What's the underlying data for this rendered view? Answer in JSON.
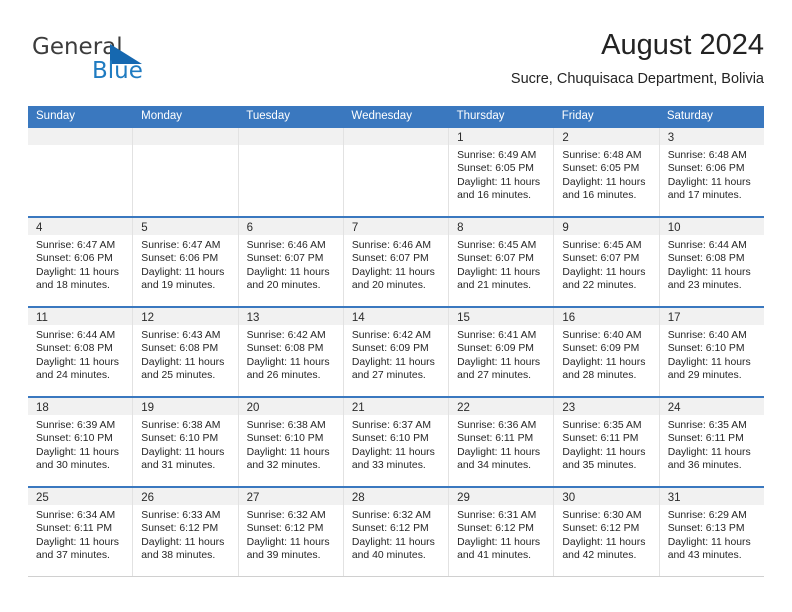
{
  "brand": {
    "name_top": "General",
    "name_bottom": "Blue",
    "color_dark": "#3c3c3c",
    "color_blue": "#1f7bc1",
    "triangle_color": "#1668b0"
  },
  "header": {
    "title": "August 2024",
    "subtitle": "Sucre, Chuquisaca Department, Bolivia"
  },
  "theme": {
    "header_row_bg": "#3a78bf",
    "header_row_text": "#ffffff",
    "week_divider": "#3a78bf",
    "day_band_bg": "#f1f1f1",
    "cell_border": "#e2e2e2"
  },
  "weekdays": [
    "Sunday",
    "Monday",
    "Tuesday",
    "Wednesday",
    "Thursday",
    "Friday",
    "Saturday"
  ],
  "labels": {
    "sunrise_prefix": "Sunrise:",
    "sunset_prefix": "Sunset:",
    "daylight_prefix": "Daylight:"
  },
  "weeks": [
    [
      {
        "day": "",
        "empty": true
      },
      {
        "day": "",
        "empty": true
      },
      {
        "day": "",
        "empty": true
      },
      {
        "day": "",
        "empty": true
      },
      {
        "day": "1",
        "sunrise": "Sunrise: 6:49 AM",
        "sunset": "Sunset: 6:05 PM",
        "daylight_1": "Daylight: 11 hours",
        "daylight_2": "and 16 minutes."
      },
      {
        "day": "2",
        "sunrise": "Sunrise: 6:48 AM",
        "sunset": "Sunset: 6:05 PM",
        "daylight_1": "Daylight: 11 hours",
        "daylight_2": "and 16 minutes."
      },
      {
        "day": "3",
        "sunrise": "Sunrise: 6:48 AM",
        "sunset": "Sunset: 6:06 PM",
        "daylight_1": "Daylight: 11 hours",
        "daylight_2": "and 17 minutes."
      }
    ],
    [
      {
        "day": "4",
        "sunrise": "Sunrise: 6:47 AM",
        "sunset": "Sunset: 6:06 PM",
        "daylight_1": "Daylight: 11 hours",
        "daylight_2": "and 18 minutes."
      },
      {
        "day": "5",
        "sunrise": "Sunrise: 6:47 AM",
        "sunset": "Sunset: 6:06 PM",
        "daylight_1": "Daylight: 11 hours",
        "daylight_2": "and 19 minutes."
      },
      {
        "day": "6",
        "sunrise": "Sunrise: 6:46 AM",
        "sunset": "Sunset: 6:07 PM",
        "daylight_1": "Daylight: 11 hours",
        "daylight_2": "and 20 minutes."
      },
      {
        "day": "7",
        "sunrise": "Sunrise: 6:46 AM",
        "sunset": "Sunset: 6:07 PM",
        "daylight_1": "Daylight: 11 hours",
        "daylight_2": "and 20 minutes."
      },
      {
        "day": "8",
        "sunrise": "Sunrise: 6:45 AM",
        "sunset": "Sunset: 6:07 PM",
        "daylight_1": "Daylight: 11 hours",
        "daylight_2": "and 21 minutes."
      },
      {
        "day": "9",
        "sunrise": "Sunrise: 6:45 AM",
        "sunset": "Sunset: 6:07 PM",
        "daylight_1": "Daylight: 11 hours",
        "daylight_2": "and 22 minutes."
      },
      {
        "day": "10",
        "sunrise": "Sunrise: 6:44 AM",
        "sunset": "Sunset: 6:08 PM",
        "daylight_1": "Daylight: 11 hours",
        "daylight_2": "and 23 minutes."
      }
    ],
    [
      {
        "day": "11",
        "sunrise": "Sunrise: 6:44 AM",
        "sunset": "Sunset: 6:08 PM",
        "daylight_1": "Daylight: 11 hours",
        "daylight_2": "and 24 minutes."
      },
      {
        "day": "12",
        "sunrise": "Sunrise: 6:43 AM",
        "sunset": "Sunset: 6:08 PM",
        "daylight_1": "Daylight: 11 hours",
        "daylight_2": "and 25 minutes."
      },
      {
        "day": "13",
        "sunrise": "Sunrise: 6:42 AM",
        "sunset": "Sunset: 6:08 PM",
        "daylight_1": "Daylight: 11 hours",
        "daylight_2": "and 26 minutes."
      },
      {
        "day": "14",
        "sunrise": "Sunrise: 6:42 AM",
        "sunset": "Sunset: 6:09 PM",
        "daylight_1": "Daylight: 11 hours",
        "daylight_2": "and 27 minutes."
      },
      {
        "day": "15",
        "sunrise": "Sunrise: 6:41 AM",
        "sunset": "Sunset: 6:09 PM",
        "daylight_1": "Daylight: 11 hours",
        "daylight_2": "and 27 minutes."
      },
      {
        "day": "16",
        "sunrise": "Sunrise: 6:40 AM",
        "sunset": "Sunset: 6:09 PM",
        "daylight_1": "Daylight: 11 hours",
        "daylight_2": "and 28 minutes."
      },
      {
        "day": "17",
        "sunrise": "Sunrise: 6:40 AM",
        "sunset": "Sunset: 6:10 PM",
        "daylight_1": "Daylight: 11 hours",
        "daylight_2": "and 29 minutes."
      }
    ],
    [
      {
        "day": "18",
        "sunrise": "Sunrise: 6:39 AM",
        "sunset": "Sunset: 6:10 PM",
        "daylight_1": "Daylight: 11 hours",
        "daylight_2": "and 30 minutes."
      },
      {
        "day": "19",
        "sunrise": "Sunrise: 6:38 AM",
        "sunset": "Sunset: 6:10 PM",
        "daylight_1": "Daylight: 11 hours",
        "daylight_2": "and 31 minutes."
      },
      {
        "day": "20",
        "sunrise": "Sunrise: 6:38 AM",
        "sunset": "Sunset: 6:10 PM",
        "daylight_1": "Daylight: 11 hours",
        "daylight_2": "and 32 minutes."
      },
      {
        "day": "21",
        "sunrise": "Sunrise: 6:37 AM",
        "sunset": "Sunset: 6:10 PM",
        "daylight_1": "Daylight: 11 hours",
        "daylight_2": "and 33 minutes."
      },
      {
        "day": "22",
        "sunrise": "Sunrise: 6:36 AM",
        "sunset": "Sunset: 6:11 PM",
        "daylight_1": "Daylight: 11 hours",
        "daylight_2": "and 34 minutes."
      },
      {
        "day": "23",
        "sunrise": "Sunrise: 6:35 AM",
        "sunset": "Sunset: 6:11 PM",
        "daylight_1": "Daylight: 11 hours",
        "daylight_2": "and 35 minutes."
      },
      {
        "day": "24",
        "sunrise": "Sunrise: 6:35 AM",
        "sunset": "Sunset: 6:11 PM",
        "daylight_1": "Daylight: 11 hours",
        "daylight_2": "and 36 minutes."
      }
    ],
    [
      {
        "day": "25",
        "sunrise": "Sunrise: 6:34 AM",
        "sunset": "Sunset: 6:11 PM",
        "daylight_1": "Daylight: 11 hours",
        "daylight_2": "and 37 minutes."
      },
      {
        "day": "26",
        "sunrise": "Sunrise: 6:33 AM",
        "sunset": "Sunset: 6:12 PM",
        "daylight_1": "Daylight: 11 hours",
        "daylight_2": "and 38 minutes."
      },
      {
        "day": "27",
        "sunrise": "Sunrise: 6:32 AM",
        "sunset": "Sunset: 6:12 PM",
        "daylight_1": "Daylight: 11 hours",
        "daylight_2": "and 39 minutes."
      },
      {
        "day": "28",
        "sunrise": "Sunrise: 6:32 AM",
        "sunset": "Sunset: 6:12 PM",
        "daylight_1": "Daylight: 11 hours",
        "daylight_2": "and 40 minutes."
      },
      {
        "day": "29",
        "sunrise": "Sunrise: 6:31 AM",
        "sunset": "Sunset: 6:12 PM",
        "daylight_1": "Daylight: 11 hours",
        "daylight_2": "and 41 minutes."
      },
      {
        "day": "30",
        "sunrise": "Sunrise: 6:30 AM",
        "sunset": "Sunset: 6:12 PM",
        "daylight_1": "Daylight: 11 hours",
        "daylight_2": "and 42 minutes."
      },
      {
        "day": "31",
        "sunrise": "Sunrise: 6:29 AM",
        "sunset": "Sunset: 6:13 PM",
        "daylight_1": "Daylight: 11 hours",
        "daylight_2": "and 43 minutes."
      }
    ]
  ]
}
